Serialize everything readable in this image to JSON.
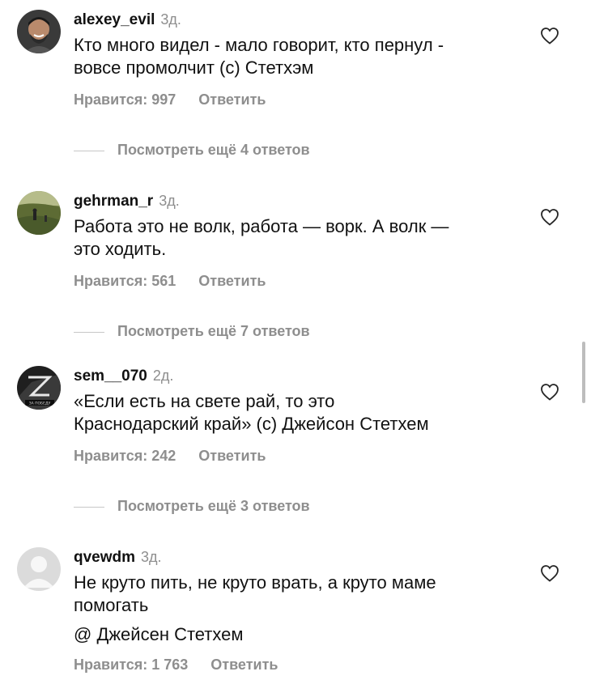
{
  "comments": [
    {
      "username": "alexey_evil",
      "time": "3д.",
      "lines": [
        "Кто много видел - мало говорит, кто пернул -",
        "вовсе промолчит (с) Стетхэм"
      ],
      "likes": "Нравится: 997",
      "reply": "Ответить",
      "more": "Посмотреть ещё 4 ответов"
    },
    {
      "username": "gehrman_r",
      "time": "3д.",
      "lines": [
        "Работа это не волк, работа — ворк. А волк —",
        "это ходить."
      ],
      "likes": "Нравится: 561",
      "reply": "Ответить",
      "more": "Посмотреть ещё 7 ответов"
    },
    {
      "username": "sem__070",
      "time": "2д.",
      "lines": [
        "«Если есть на свете рай, то это",
        "Краснодарский край» (с) Джейсон Стетхем"
      ],
      "likes": "Нравится: 242",
      "reply": "Ответить",
      "more": "Посмотреть ещё 3 ответов",
      "avatar_caption": "ЗА ПОБЕДУ"
    },
    {
      "username": "qvewdm",
      "time": "3д.",
      "lines": [
        "Не круто пить, не круто врать, а круто маме",
        "помогать"
      ],
      "extra": "@ Джейсен Стетхем",
      "likes": "Нравится: 1 763",
      "reply": "Ответить"
    }
  ],
  "colors": {
    "text": "#111111",
    "secondary": "#8e8e8e",
    "divider": "#c7c7c7"
  },
  "icons": [
    "heart-icon",
    "avatar"
  ]
}
